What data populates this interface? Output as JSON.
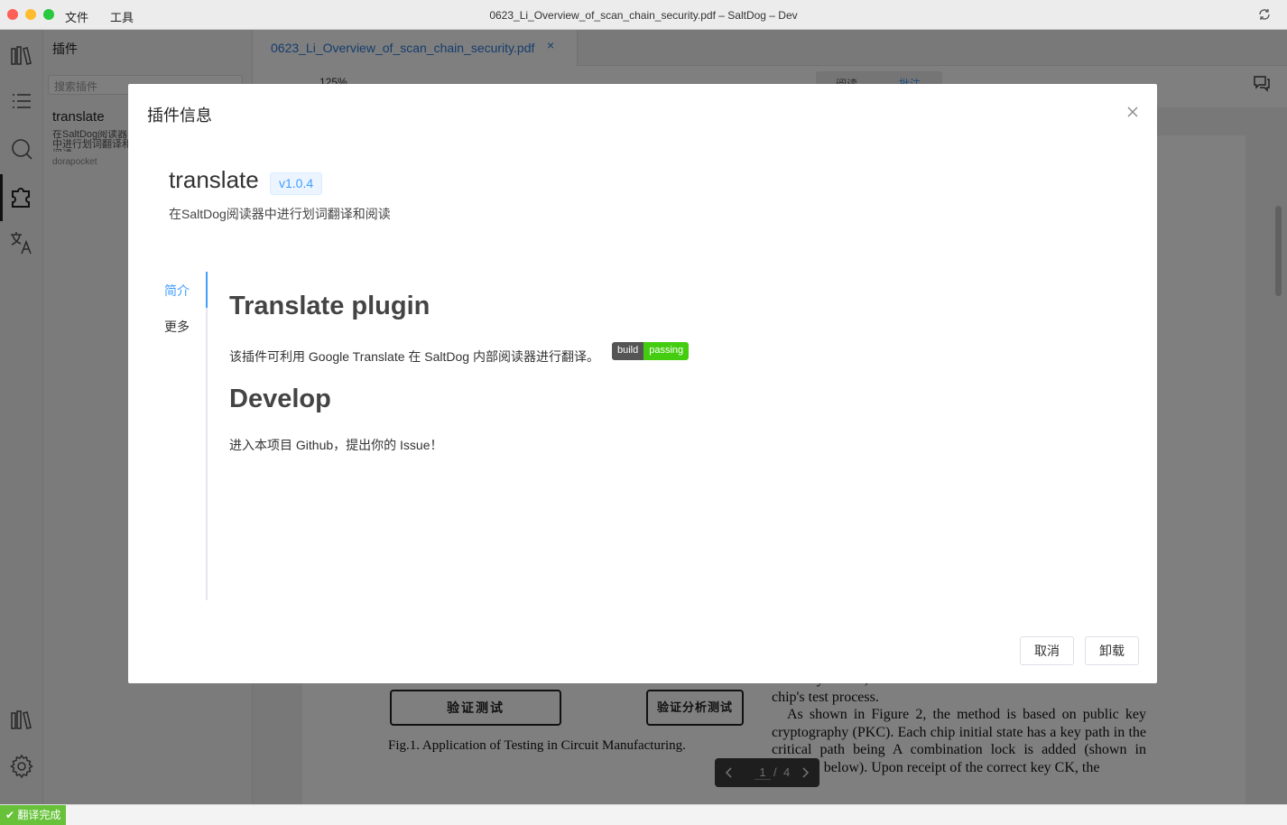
{
  "titlebar": {
    "menu": [
      "文件",
      "工具"
    ],
    "window_title": "0623_Li_Overview_of_scan_chain_security.pdf – SaltDog – Dev"
  },
  "activity_bar": {
    "icons": [
      "library-icon",
      "list-icon",
      "search-icon",
      "plugin-icon",
      "translate-icon",
      "library-bottom-icon",
      "gear-icon"
    ],
    "active": "plugin-icon"
  },
  "side_panel": {
    "title": "插件",
    "search_placeholder": "搜索插件",
    "plugin": {
      "name": "translate",
      "desc": "在SaltDog阅读器中进行划词翻译和阅读",
      "author": "dorapocket"
    }
  },
  "editor": {
    "tab_label": "0623_Li_Overview_of_scan_chain_security.pdf",
    "tab_close": "×",
    "zoom": "125%",
    "mode_read": "阅读",
    "mode_annotate": "批注",
    "figure": {
      "box_left": "验证测试",
      "box_right": "验证分析测试",
      "caption": "Fig.1. Application of Testing in Circuit Manufacturing."
    },
    "paper_text": [
      "authority owner, who returns an activation code to activate the chip's test process.",
      "As shown in Figure 2, the method is based on public key cryptography (PKC). Each chip initial state has a key path in the critical path being A combination lock is added (shown in Figure 3 below). Upon receipt of the correct key CK, the"
    ],
    "pager": {
      "current": "1",
      "sep": "/",
      "total": "4"
    }
  },
  "modal": {
    "title": "插件信息",
    "plugin_name": "translate",
    "version": "v1.0.4",
    "description": "在SaltDog阅读器中进行划词翻译和阅读",
    "tabs": [
      "简介",
      "更多"
    ],
    "active_tab": "简介",
    "readme": {
      "h1": "Translate plugin",
      "p1": "该插件可利用 Google Translate 在 SaltDog 内部阅读器进行翻译。",
      "badge_left": "build",
      "badge_right": "passing",
      "h2": "Develop",
      "p2": "进入本项目 Github，提出你的 Issue！"
    },
    "buttons": {
      "cancel": "取消",
      "uninstall": "卸载"
    }
  },
  "statusbar": {
    "message": "✔ 翻译完成"
  },
  "colors": {
    "accent": "#409eff",
    "tab_text": "#2a7ad8",
    "status_ok": "#67c23a",
    "badge_pass": "#44cc11"
  }
}
